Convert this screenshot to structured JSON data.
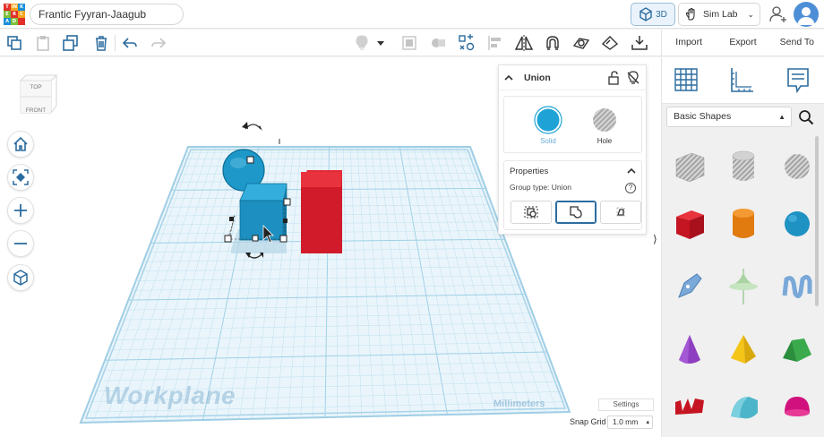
{
  "app": {
    "project_title": "Frantic Fyyran-Jaagub",
    "logo_letters": [
      "T",
      "IN",
      "K",
      "E",
      "R",
      "C",
      "A",
      "D",
      ""
    ],
    "view_mode_label": "3D",
    "sim_lab_label": "Sim Lab"
  },
  "actions": {
    "import_label": "Import",
    "export_label": "Export",
    "send_to_label": "Send To"
  },
  "viewcube": {
    "top_label": "TOP",
    "front_label": "FRONT"
  },
  "workplane": {
    "label": "Workplane",
    "units_label": "Millimeters",
    "settings_label": "Settings",
    "snap_grid_label": "Snap Grid",
    "snap_grid_value": "1.0 mm"
  },
  "inspector": {
    "title": "Union",
    "solid_label": "Solid",
    "hole_label": "Hole",
    "properties_label": "Properties",
    "group_type_label": "Group type: Union",
    "help_label": "?"
  },
  "library": {
    "category_selected": "Basic Shapes"
  },
  "colors": {
    "accent": "#2b6c9f",
    "selection_blue": "#1fa3d6",
    "box_red": "#d9162a",
    "grid_line": "#bcdcec",
    "workplane_fill": "#e8f4fa"
  }
}
